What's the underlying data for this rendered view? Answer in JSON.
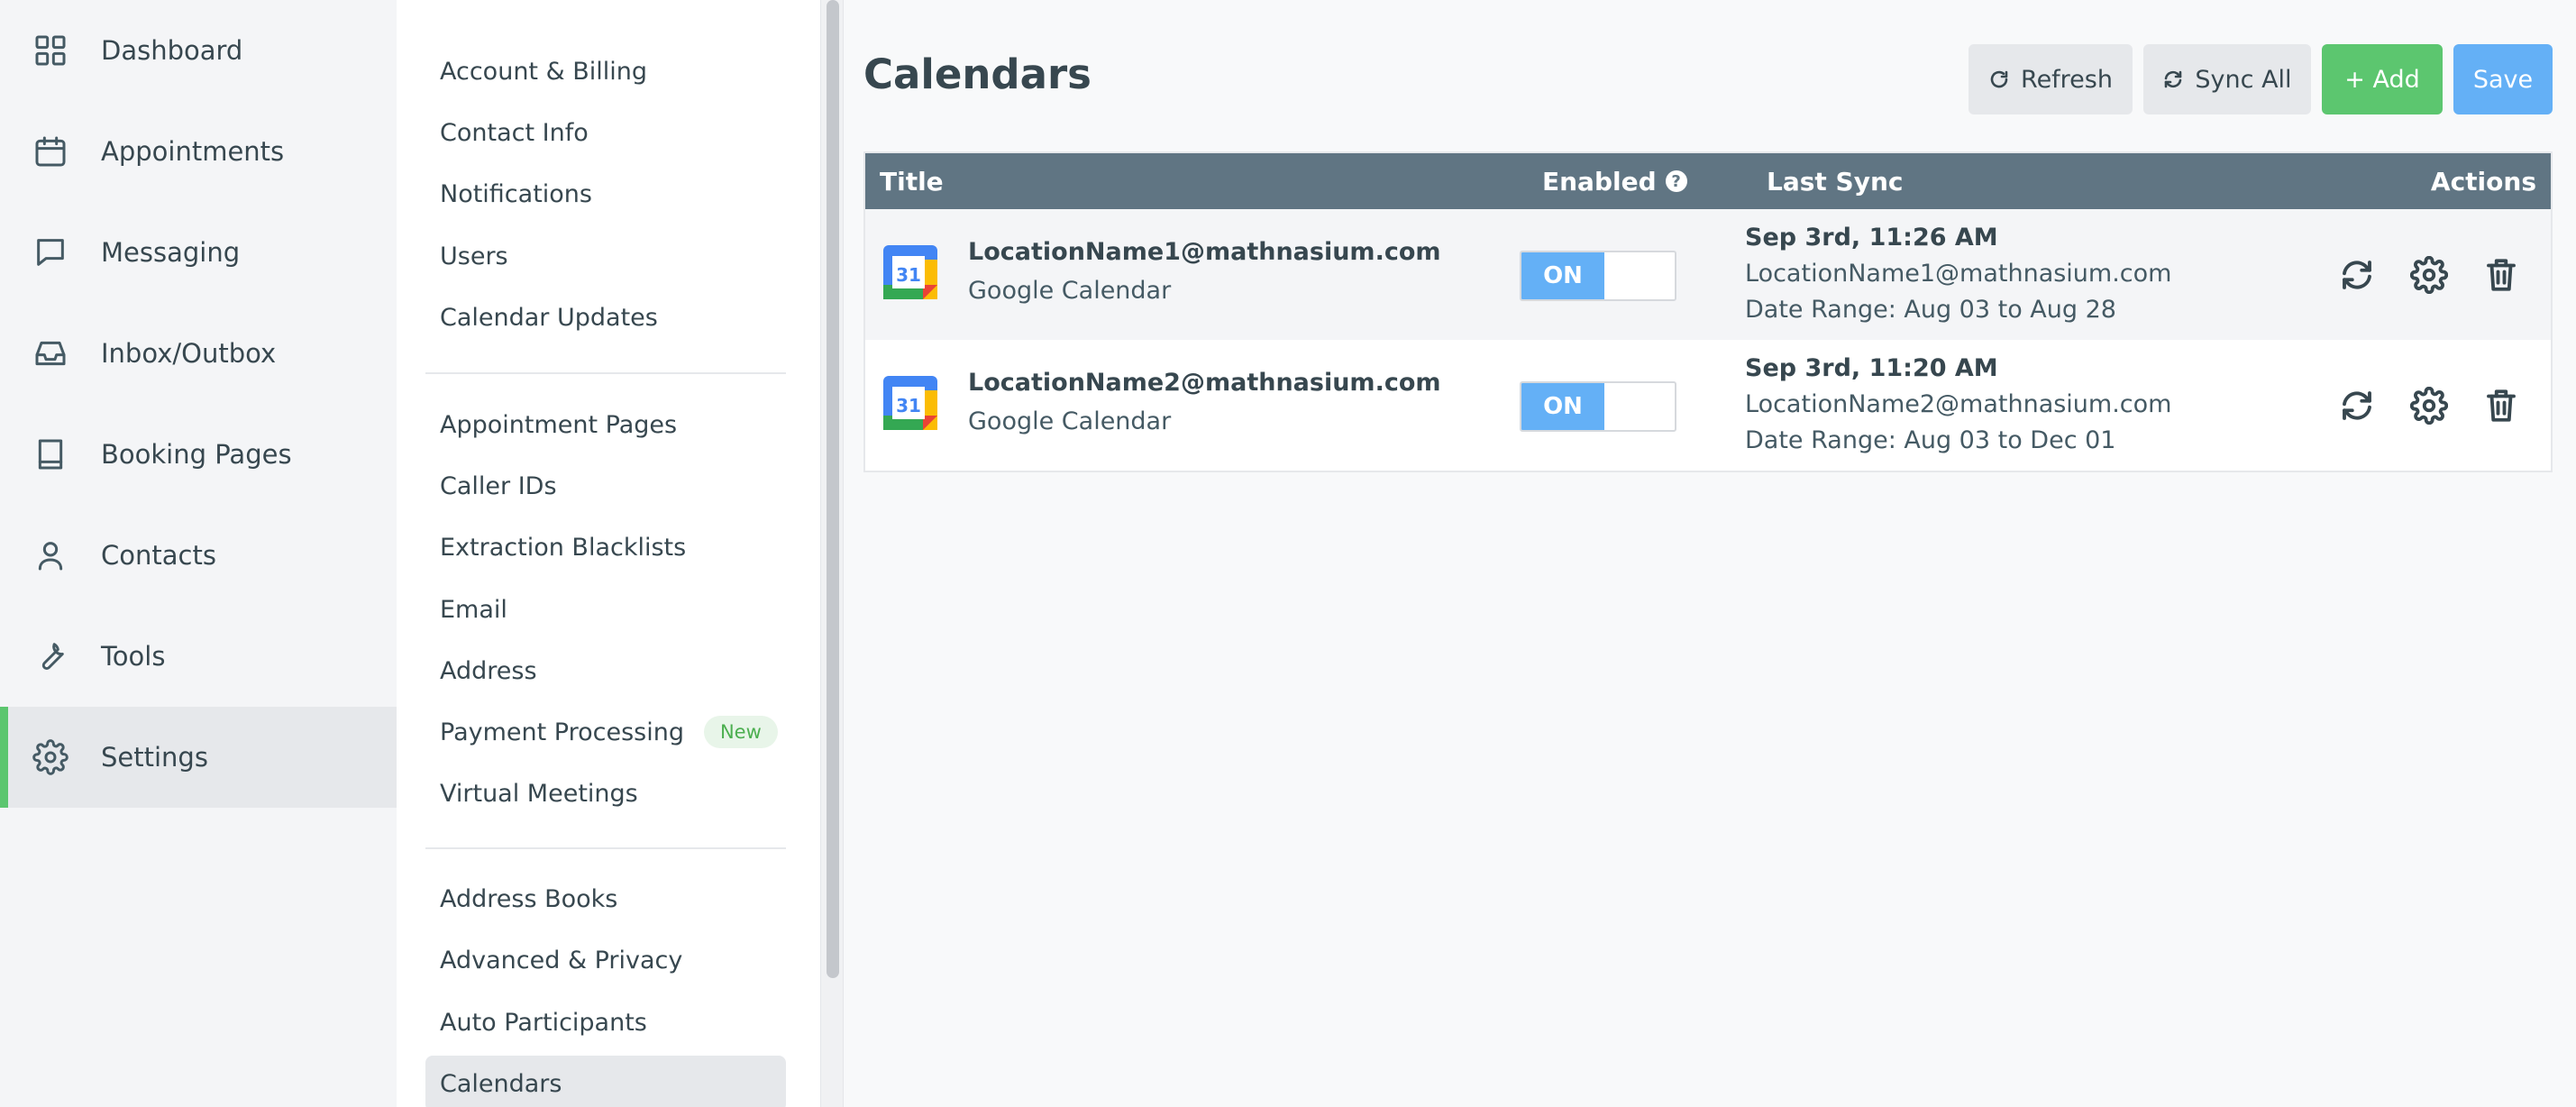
{
  "nav": {
    "items": [
      {
        "label": "Dashboard",
        "icon": "grid-icon"
      },
      {
        "label": "Appointments",
        "icon": "calendar-icon"
      },
      {
        "label": "Messaging",
        "icon": "chat-icon"
      },
      {
        "label": "Inbox/Outbox",
        "icon": "inbox-icon"
      },
      {
        "label": "Booking Pages",
        "icon": "book-icon"
      },
      {
        "label": "Contacts",
        "icon": "user-icon"
      },
      {
        "label": "Tools",
        "icon": "wrench-icon"
      },
      {
        "label": "Settings",
        "icon": "gear-icon",
        "active": true
      }
    ]
  },
  "submenu": {
    "group1": [
      "Account & Billing",
      "Contact Info",
      "Notifications",
      "Users",
      "Calendar Updates"
    ],
    "group2": [
      "Appointment Pages",
      "Caller IDs",
      "Extraction Blacklists",
      "Email",
      "Address",
      "Payment Processing",
      "Virtual Meetings"
    ],
    "group3": [
      "Address Books",
      "Advanced & Privacy",
      "Auto Participants",
      "Calendars"
    ],
    "new_badge": "New",
    "active": "Calendars"
  },
  "page": {
    "title": "Calendars",
    "toolbar": {
      "refresh": "Refresh",
      "sync_all": "Sync All",
      "add": "+ Add",
      "save": "Save"
    }
  },
  "table": {
    "headers": {
      "title": "Title",
      "enabled": "Enabled",
      "enabled_help": "?",
      "last_sync": "Last Sync",
      "actions": "Actions"
    },
    "rows": [
      {
        "email": "LocationName1@mathnasium.com",
        "type": "Google Calendar",
        "enabled": "ON",
        "sync_time": "Sep 3rd, 11:26 AM",
        "sync_account": "LocationName1@mathnasium.com",
        "date_range": "Date Range: Aug 03 to Aug 28"
      },
      {
        "email": "LocationName2@mathnasium.com",
        "type": "Google Calendar",
        "enabled": "ON",
        "sync_time": "Sep 3rd, 11:20 AM",
        "sync_account": "LocationName2@mathnasium.com",
        "date_range": "Date Range: Aug 03 to Dec 01"
      }
    ]
  },
  "colors": {
    "accent_green": "#5cc66f",
    "accent_blue": "#64b0f6",
    "table_header": "#607583"
  }
}
